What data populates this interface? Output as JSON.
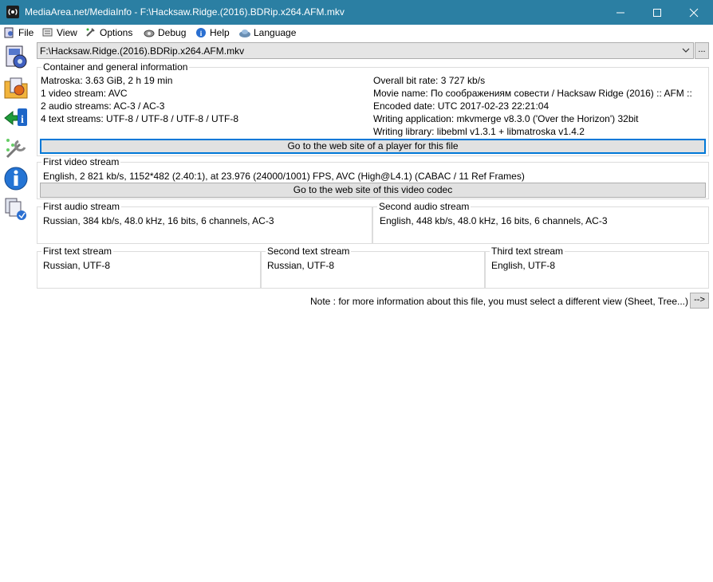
{
  "window": {
    "title": "MediaArea.net/MediaInfo - F:\\Hacksaw.Ridge.(2016).BDRip.x264.AFM.mkv",
    "controls": [
      "minimize",
      "maximize",
      "close"
    ]
  },
  "menu": [
    {
      "label": "File",
      "icon": "file-icon"
    },
    {
      "label": "View",
      "icon": "view-icon"
    },
    {
      "label": "Options",
      "icon": "options-icon"
    },
    {
      "label": "Debug",
      "icon": "debug-icon"
    },
    {
      "label": "Help",
      "icon": "help-icon"
    },
    {
      "label": "Language",
      "icon": "language-icon"
    }
  ],
  "sidebar": [
    "open-file-icon",
    "open-folder-icon",
    "export-icon",
    "preferences-icon",
    "about-icon",
    "knowledge-base-icon"
  ],
  "file_select": {
    "value": "F:\\Hacksaw.Ridge.(2016).BDRip.x264.AFM.mkv",
    "browse_label": "..."
  },
  "general": {
    "title": "Container and general information",
    "left": [
      "Matroska: 3.63 GiB, 2 h 19 min",
      "1 video stream: AVC",
      "2 audio streams: AC-3 / AC-3",
      "4 text streams: UTF-8 / UTF-8 / UTF-8 / UTF-8"
    ],
    "right": [
      "Overall bit rate: 3 727 kb/s",
      "Movie name: По соображениям совести / Hacksaw Ridge (2016) :: AFM ::",
      "Encoded date: UTC 2017-02-23 22:21:04",
      "Writing application: mkvmerge v8.3.0 ('Over the Horizon') 32bit",
      "Writing library: libebml v1.3.1 + libmatroska v1.4.2"
    ],
    "button": "Go to the web site of a player for this file"
  },
  "video": {
    "title": "First video stream",
    "line": "English, 2 821 kb/s, 1152*482 (2.40:1), at 23.976 (24000/1001) FPS, AVC (High@L4.1) (CABAC / 11 Ref Frames)",
    "button": "Go to the web site of this video codec"
  },
  "audio": [
    {
      "title": "First audio stream",
      "line": "Russian, 384 kb/s, 48.0 kHz, 16 bits, 6 channels, AC-3"
    },
    {
      "title": "Second audio stream",
      "line": "English, 448 kb/s, 48.0 kHz, 16 bits, 6 channels, AC-3"
    }
  ],
  "text": [
    {
      "title": "First text stream",
      "line": "Russian, UTF-8"
    },
    {
      "title": "Second text stream",
      "line": "Russian, UTF-8"
    },
    {
      "title": "Third text stream",
      "line": "English, UTF-8"
    }
  ],
  "note": {
    "text": "Note : for more information about this file, you must select a different view (Sheet, Tree...)",
    "button": "-->"
  },
  "colors": {
    "titlebar": "#2b7fa3",
    "focus": "#0078d7",
    "button_face": "#e1e1e1",
    "group_border": "#dcdcdc"
  }
}
